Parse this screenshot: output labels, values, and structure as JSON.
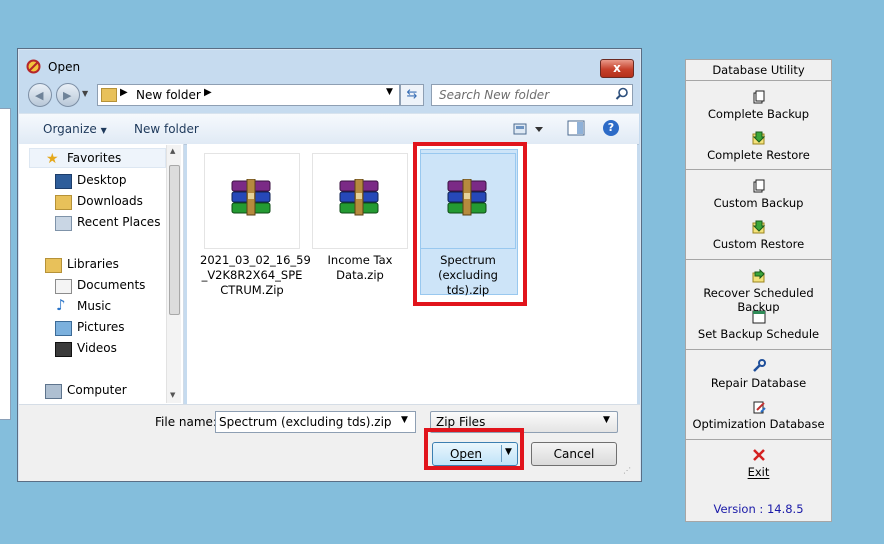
{
  "dialog": {
    "title": "Open",
    "close_label": "x",
    "address": {
      "folder": "New folder"
    },
    "search": {
      "placeholder": "Search New folder"
    },
    "toolbar": {
      "organize": "Organize",
      "new_folder": "New folder"
    },
    "nav": {
      "favorites": "Favorites",
      "desktop": "Desktop",
      "downloads": "Downloads",
      "recent_places": "Recent Places",
      "libraries": "Libraries",
      "documents": "Documents",
      "music": "Music",
      "pictures": "Pictures",
      "videos": "Videos",
      "computer": "Computer"
    },
    "files": [
      {
        "name_lines": [
          "2021_03_02_16_59",
          "_V2K8R2X64_SPE",
          "CTRUM.Zip"
        ],
        "selected": false
      },
      {
        "name_lines": [
          "Income Tax",
          "Data.zip"
        ],
        "selected": false
      },
      {
        "name_lines": [
          "Spectrum",
          "(excluding",
          "tds).zip"
        ],
        "selected": true
      }
    ],
    "bottom": {
      "file_name_label": "File name:",
      "file_name_value": "Spectrum (excluding tds).zip",
      "file_type_value": "Zip Files",
      "open_label": "Open",
      "cancel_label": "Cancel"
    }
  },
  "side_panel": {
    "title": "Database Utility",
    "items": {
      "complete_backup": "Complete Backup",
      "complete_restore": "Complete Restore",
      "custom_backup": "Custom Backup",
      "custom_restore": "Custom Restore",
      "recover_scheduled_backup": "Recover Scheduled Backup",
      "set_backup_schedule": "Set Backup Schedule",
      "repair_database": "Repair Database",
      "optimization_database": "Optimization Database",
      "exit": "Exit"
    },
    "version": "Version : 14.8.5"
  },
  "colors": {
    "highlight": "#e1141c",
    "desktop": "#84bedc"
  }
}
